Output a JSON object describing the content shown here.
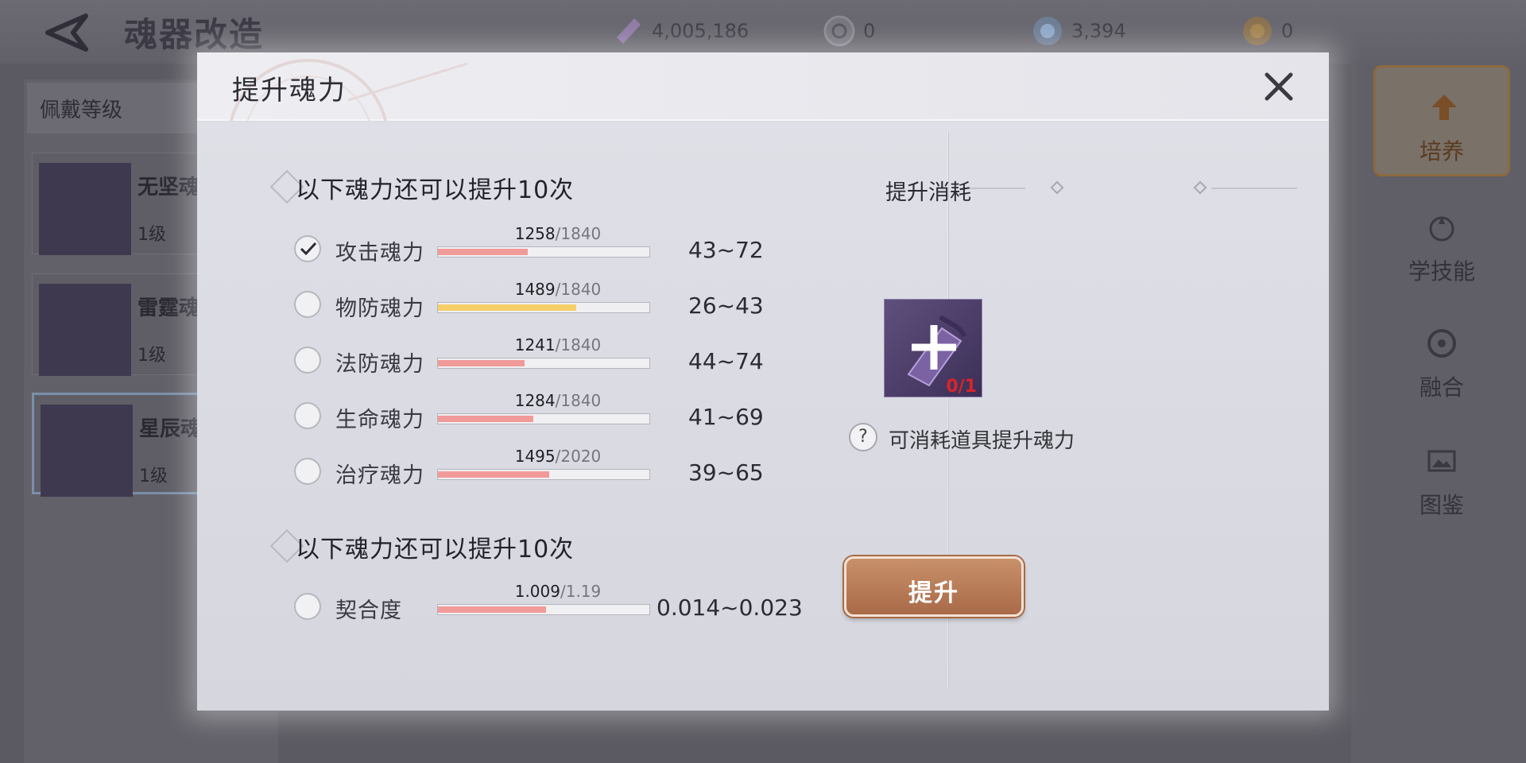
{
  "screen": {
    "title": "魂器改造",
    "currencies": [
      {
        "icon": "soul-crystal-icon",
        "value": "4,005,186"
      },
      {
        "icon": "silver-coin-icon",
        "value": "0"
      },
      {
        "icon": "blue-gem-icon",
        "value": "3,394"
      },
      {
        "icon": "gold-medal-icon",
        "value": "0"
      }
    ],
    "left_panel": {
      "label": "佩戴等级",
      "items": [
        {
          "name": "无坚魂",
          "level": "1级"
        },
        {
          "name": "雷霆魂",
          "level": "1级"
        },
        {
          "name": "星辰魂",
          "level": "1级"
        }
      ]
    },
    "right_tabs": [
      {
        "label": "培养"
      },
      {
        "label": "学技能"
      },
      {
        "label": "融合"
      },
      {
        "label": "图鉴"
      }
    ]
  },
  "dialog": {
    "title": "提升魂力",
    "section1_title": "以下魂力还可以提升10次",
    "section2_title": "以下魂力还可以提升10次",
    "stats": [
      {
        "label": "攻击魂力",
        "current": "1258",
        "max": "/1840",
        "fraction": 0.424,
        "range": "43~72",
        "checked": true,
        "color": "red"
      },
      {
        "label": "物防魂力",
        "current": "1489",
        "max": "/1840",
        "fraction": 0.653,
        "range": "26~43",
        "checked": false,
        "color": "yellow"
      },
      {
        "label": "法防魂力",
        "current": "1241",
        "max": "/1840",
        "fraction": 0.41,
        "range": "44~74",
        "checked": false,
        "color": "red"
      },
      {
        "label": "生命魂力",
        "current": "1284",
        "max": "/1840",
        "fraction": 0.452,
        "range": "41~69",
        "checked": false,
        "color": "red"
      },
      {
        "label": "治疗魂力",
        "current": "1495",
        "max": "/2020",
        "fraction": 0.526,
        "range": "39~65",
        "checked": false,
        "color": "red"
      }
    ],
    "affinity": {
      "label": "契合度",
      "current": "1.009",
      "max": "/1.19",
      "fraction": 0.51,
      "range": "0.014~0.023",
      "checked": false
    },
    "cost": {
      "title": "提升消耗",
      "item_count": "0/1",
      "help_text": "可消耗道具提升魂力",
      "help_icon": "?",
      "button_label": "提升"
    }
  }
}
